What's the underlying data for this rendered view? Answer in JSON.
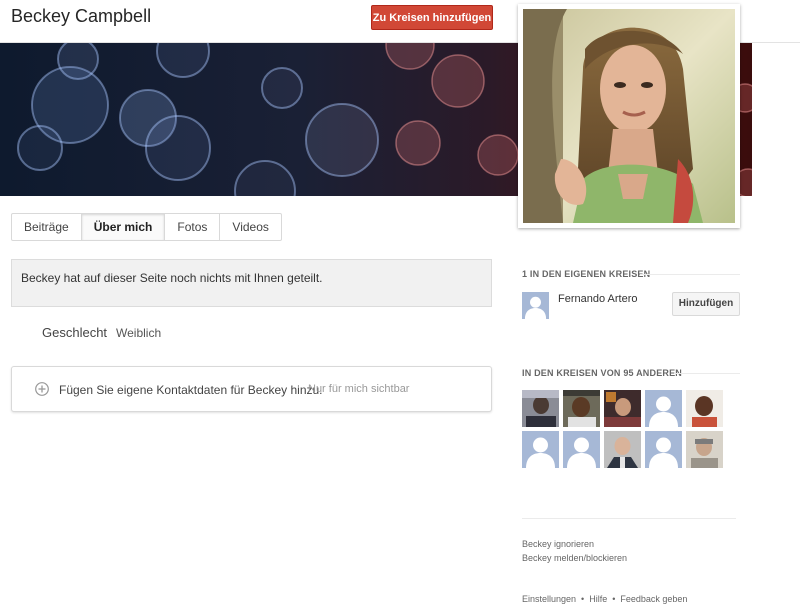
{
  "header": {
    "name": "Beckey Campbell",
    "add_button": "Zu Kreisen hinzufügen"
  },
  "tabs": [
    {
      "label": "Beiträge",
      "active": false
    },
    {
      "label": "Über mich",
      "active": true
    },
    {
      "label": "Fotos",
      "active": false
    },
    {
      "label": "Videos",
      "active": false
    }
  ],
  "notice": "Beckey hat auf dieser Seite noch nichts mit Ihnen geteilt.",
  "about": {
    "gender_label": "Geschlecht",
    "gender_value": "Weiblich"
  },
  "contact": {
    "text": "Fügen Sie eigene Kontaktdaten für Beckey hinzu.",
    "visibility": "Nur für mich sichtbar"
  },
  "own_circles": {
    "heading": "1 IN DEN EIGENEN KREISEN",
    "person": "Fernando Artero",
    "button": "Hinzufügen"
  },
  "others_circles": {
    "heading": "IN DEN KREISEN VON 95 ANDEREN"
  },
  "actions": {
    "ignore": "Beckey ignorieren",
    "report": "Beckey melden/blockieren"
  },
  "footer": {
    "settings": "Einstellungen",
    "help": "Hilfe",
    "feedback": "Feedback geben"
  },
  "colors": {
    "accent_red": "#d14836",
    "default_avatar": "#a6b8d6"
  }
}
